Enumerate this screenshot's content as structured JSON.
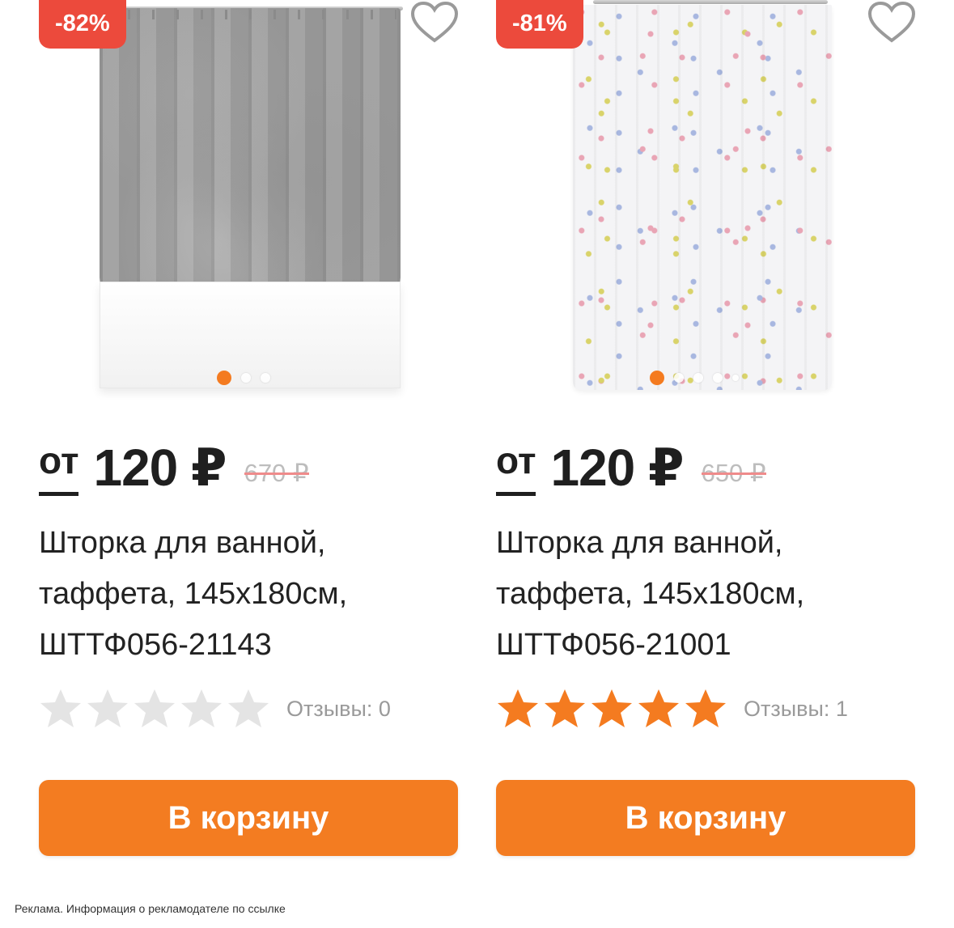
{
  "products": [
    {
      "discount": "-82%",
      "price_prefix": "от",
      "price": "120 ₽",
      "old_price": "670 ₽",
      "title_lines": [
        "Шторка для ванной,",
        "таффета, 145х180см,",
        "ШТТФ056-21143"
      ],
      "rating": 0,
      "reviews": "Отзывы: 0",
      "cart_label": "В корзину",
      "image": "grey-marble-shower-curtain-over-bathtub"
    },
    {
      "discount": "-81%",
      "price_prefix": "от",
      "price": "120 ₽",
      "old_price": "650 ₽",
      "title_lines": [
        "Шторка для ванной,",
        "таффета, 145х180см,",
        "ШТТФ056-21001"
      ],
      "rating": 5,
      "reviews": "Отзывы: 1",
      "cart_label": "В корзину",
      "image": "white-floral-shower-curtain"
    }
  ],
  "ad_note": "Реклама. Информация о рекламодателе по ссылке",
  "colors": {
    "accent": "#f37c21",
    "badge": "#ec4a3c",
    "star_filled": "#f47b20",
    "star_empty": "#e4e4e4"
  },
  "icons": [
    "heart-icon",
    "star-icon"
  ]
}
